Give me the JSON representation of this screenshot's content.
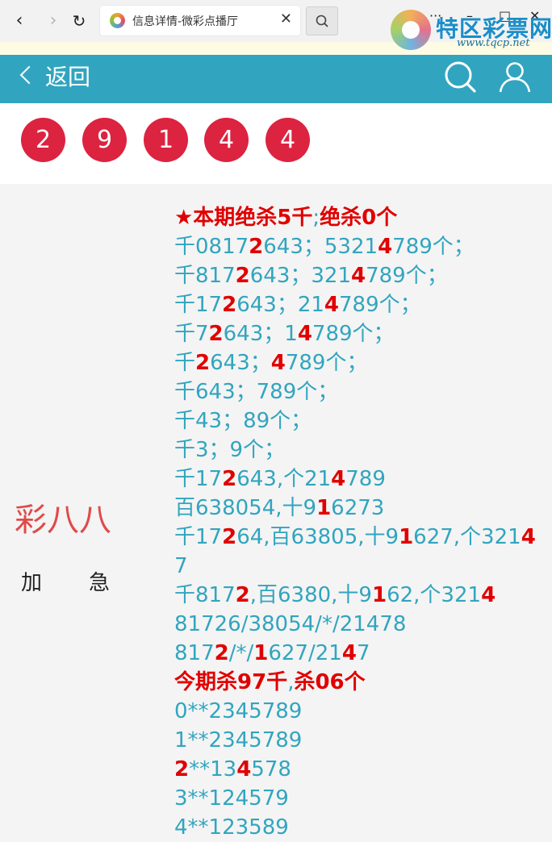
{
  "browser": {
    "tab_title": "信息详情-微彩点播厅",
    "tab_close": "✕",
    "back_glyph": "‹",
    "forward_glyph": "›",
    "refresh_glyph": "↻",
    "more_glyph": "···",
    "minimize_glyph": "–",
    "maximize_glyph": "□",
    "close_glyph": "✕"
  },
  "watermark": {
    "text": "特区彩票网",
    "url": "www.tqcp.net"
  },
  "header": {
    "back_label": "返回"
  },
  "balls": [
    "2",
    "9",
    "1",
    "4",
    "4"
  ],
  "left": {
    "title": "彩八八",
    "sub_1": "加",
    "sub_2": "急"
  },
  "colors": {
    "accent": "#31a5bf",
    "ball": "#dc2340",
    "highlight": "#e00000",
    "title_red": "#e04a4a"
  },
  "content": {
    "line_0": "★本期绝杀5千",
    "line_0b": ";",
    "line_0c": "绝杀0个",
    "l1": [
      "千0817",
      "2",
      "643；5321",
      "4",
      "789个；"
    ],
    "l2": [
      "千817",
      "2",
      "643；321",
      "4",
      "789个；"
    ],
    "l3": [
      "千17",
      "2",
      "643；21",
      "4",
      "789个；"
    ],
    "l4": [
      "千7",
      "2",
      "643；1",
      "4",
      "789个；"
    ],
    "l5": [
      "千",
      "2",
      "643；",
      "4",
      "789个；"
    ],
    "l6": "千643；789个；",
    "l7": "千43；89个；",
    "l8": "千3；9个；",
    "l9": [
      "千17",
      "2",
      "643,个21",
      "4",
      "789"
    ],
    "l10": [
      "百638054,十9",
      "1",
      "6273"
    ],
    "l11": [
      "千17",
      "2",
      "64,百63805,十9",
      "1",
      "627,个321",
      "4"
    ],
    "l11b": "7",
    "l12": [
      "千817",
      "2",
      ",百6380,十9",
      "1",
      "62,个321",
      "4"
    ],
    "l13": "81726/38054/*/21478",
    "l14": [
      "817",
      "2",
      "/*/",
      "1",
      "627/21",
      "4",
      "7"
    ],
    "l15a": "今期杀97千",
    "l15b": ",",
    "l15c": "杀06个",
    "l16": "0**2345789",
    "l17": "1**2345789",
    "l18": [
      "2",
      "**13",
      "4",
      "578"
    ],
    "l19": "3**124579",
    "l20": "4**123589"
  }
}
